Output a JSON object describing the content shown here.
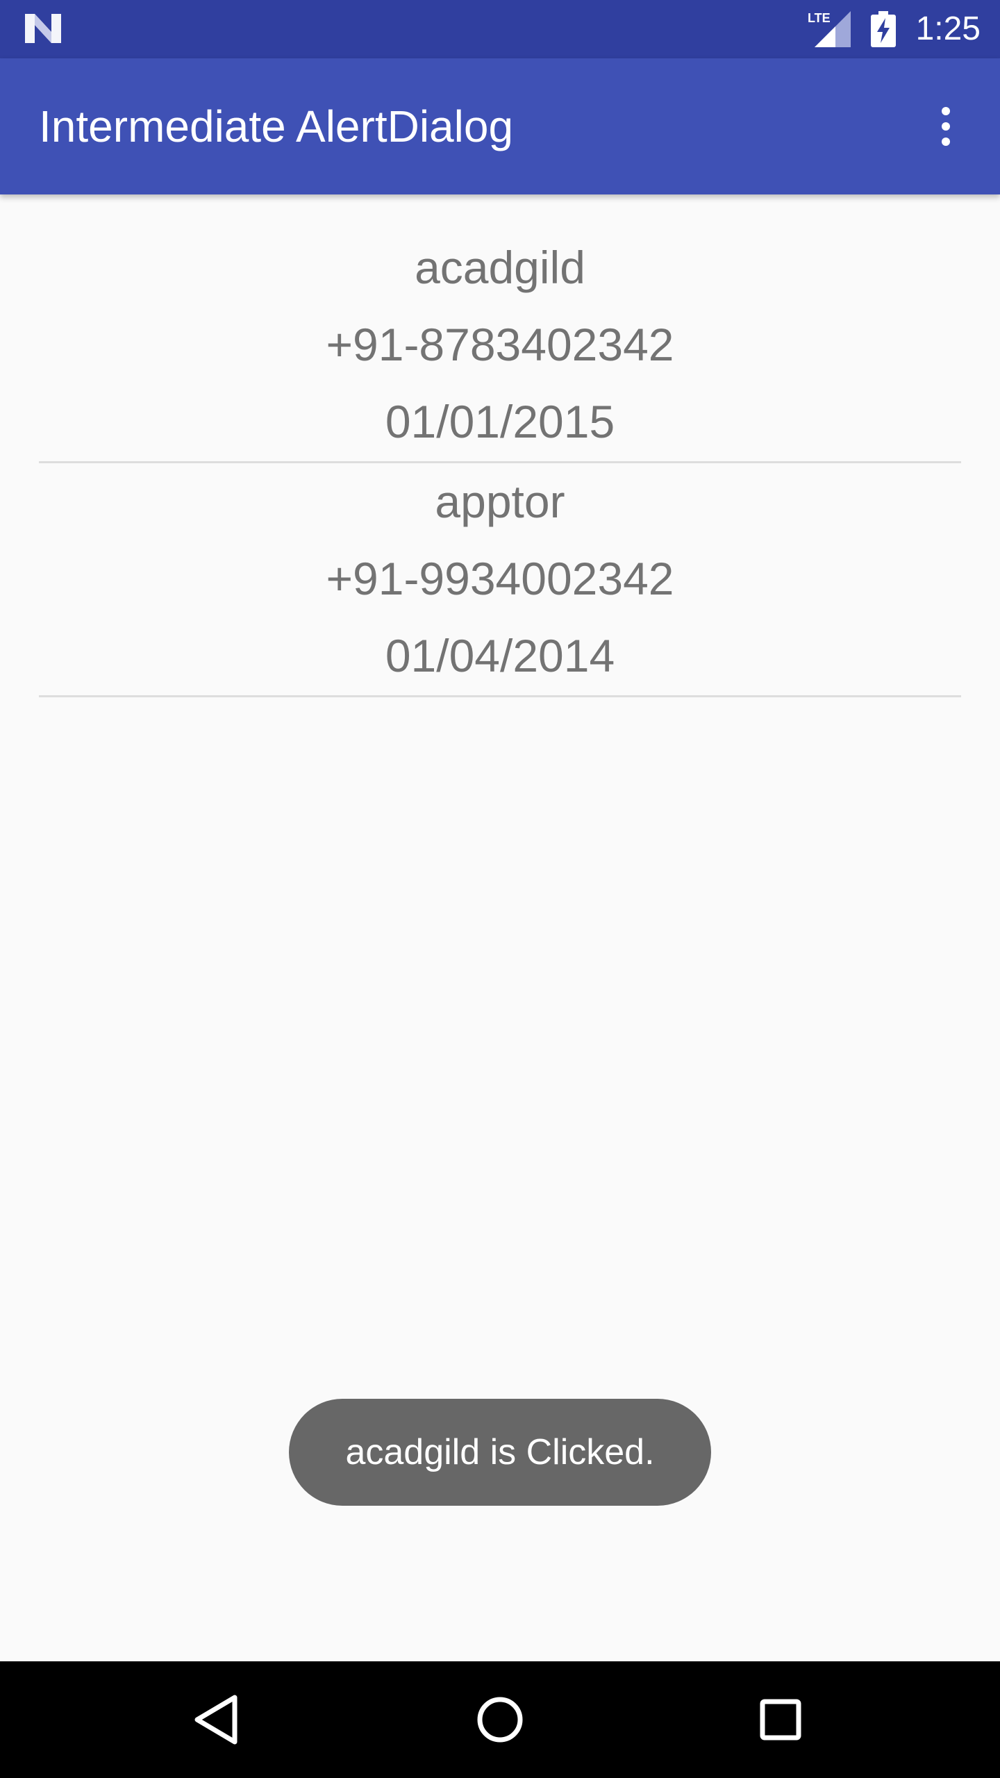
{
  "status_bar": {
    "network_label": "LTE",
    "time": "1:25",
    "icons": [
      "android-n-icon",
      "lte-signal-icon",
      "battery-charging-icon"
    ]
  },
  "app_bar": {
    "title": "Intermediate AlertDialog",
    "menu_icon": "overflow-menu-icon"
  },
  "contacts": [
    {
      "name": "acadgild",
      "phone": "+91-8783402342",
      "date": "01/01/2015"
    },
    {
      "name": "apptor",
      "phone": "+91-9934002342",
      "date": "01/04/2014"
    }
  ],
  "toast": {
    "message": "acadgild is Clicked."
  },
  "nav_bar": {
    "icons": [
      "back-icon",
      "home-icon",
      "recents-icon"
    ]
  },
  "colors": {
    "status_bar": "#303f9f",
    "app_bar": "#3f51b5",
    "background": "#fafafa",
    "list_text": "#737373",
    "divider": "#dddddd",
    "toast_background": "#676767",
    "nav_bar": "#000000"
  }
}
